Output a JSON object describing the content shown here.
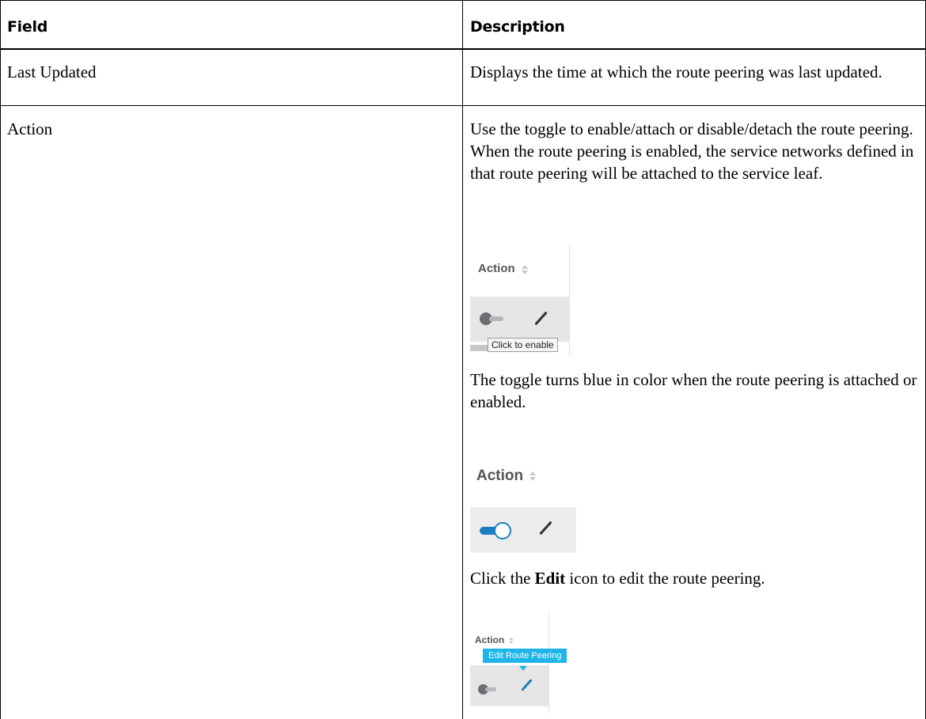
{
  "table": {
    "header": {
      "field": "Field",
      "description": "Description"
    },
    "rows": [
      {
        "field": "Last Updated",
        "description": "Displays the time at which the route peering was last updated."
      },
      {
        "field": "Action",
        "description_intro": "Use the toggle to enable/attach or disable/detach the route peering. When the route peering is enabled, the service networks defined in that route peering will be attached to the service leaf.",
        "description_toggle": "The toggle turns blue in color when the route peering is attached or enabled.",
        "description_edit": {
          "prefix": "Click the ",
          "bold": "Edit",
          "suffix": " icon to edit the route peering."
        }
      }
    ]
  },
  "screenshots": {
    "disabled": {
      "column_header": "Action",
      "tooltip": "Click to enable",
      "toggle_state": "off",
      "icons": [
        "sort-icon",
        "toggle-icon",
        "edit-pencil-icon"
      ]
    },
    "enabled": {
      "column_header": "Action",
      "toggle_state": "on",
      "toggle_color": "#1a7fc1",
      "icons": [
        "sort-icon",
        "toggle-icon",
        "edit-pencil-icon"
      ]
    },
    "edit": {
      "column_header": "Action",
      "tooltip": "Edit Route Peering",
      "tooltip_color": "#1fb5e8",
      "pencil_color": "#1a7fc1",
      "icons": [
        "sort-icon",
        "toggle-icon",
        "edit-pencil-icon"
      ]
    }
  }
}
